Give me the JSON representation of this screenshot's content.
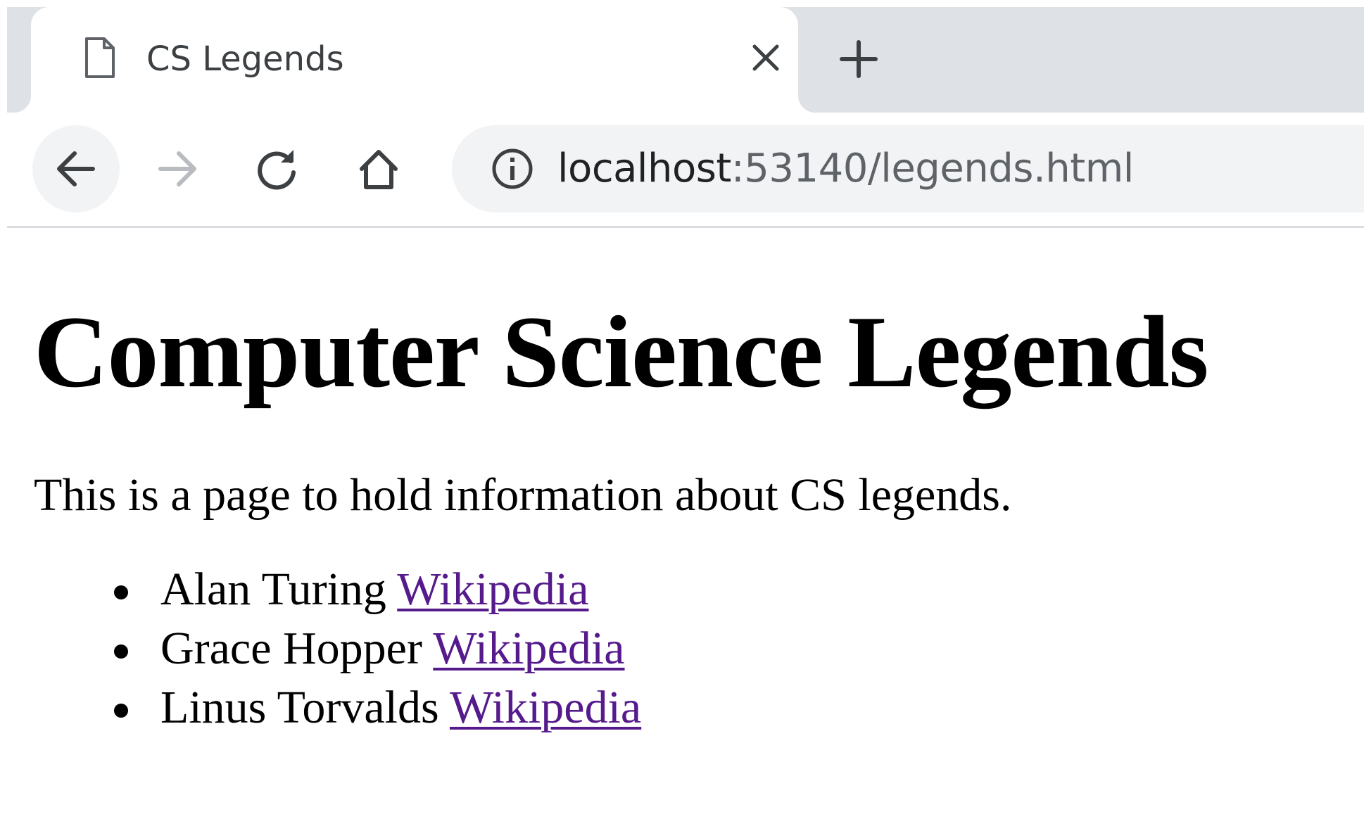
{
  "browser": {
    "tab": {
      "title": "CS Legends",
      "icon": "document-icon",
      "close_icon": "close-icon"
    },
    "new_tab_icon": "plus-icon",
    "toolbar": {
      "back_icon": "arrow-left-icon",
      "forward_icon": "arrow-right-icon",
      "reload_icon": "reload-icon",
      "home_icon": "home-icon",
      "info_icon": "info-icon"
    },
    "address": {
      "host": "localhost",
      "rest": ":53140/legends.html"
    },
    "colors": {
      "tabstrip": "#dee1e6",
      "omnibox": "#f1f3f4",
      "visited_link": "#551a8b"
    }
  },
  "page": {
    "heading": "Computer Science Legends",
    "intro": "This is a page to hold information about CS legends.",
    "legends": [
      {
        "name": "Alan Turing",
        "link": "Wikipedia"
      },
      {
        "name": "Grace Hopper",
        "link": "Wikipedia"
      },
      {
        "name": "Linus Torvalds",
        "link": "Wikipedia"
      }
    ]
  }
}
